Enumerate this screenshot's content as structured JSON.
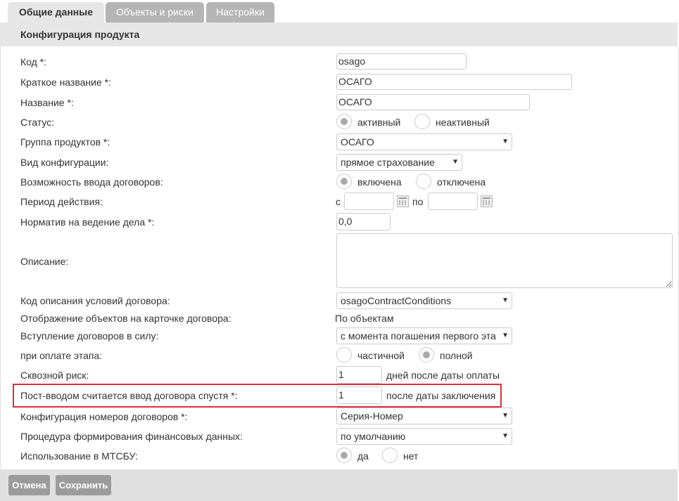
{
  "tabs": [
    {
      "label": "Общие данные"
    },
    {
      "label": "Объекты и риски"
    },
    {
      "label": "Настройки"
    }
  ],
  "section_title": "Конфигурация продукта",
  "fields": {
    "code": {
      "label": "Код *:",
      "value": "osago"
    },
    "short_name": {
      "label": "Краткое название *:",
      "value": "ОСАГО"
    },
    "name": {
      "label": "Название *:",
      "value": "ОСАГО"
    },
    "status": {
      "label": "Статус:",
      "options": [
        "активный",
        "неактивный"
      ],
      "selected": "активный"
    },
    "product_group": {
      "label": "Группа продуктов *:",
      "value": "ОСАГО"
    },
    "config_type": {
      "label": "Вид конфигурации:",
      "value": "прямое страхование"
    },
    "contract_input": {
      "label": "Возможность ввода договоров:",
      "options": [
        "включена",
        "отключена"
      ],
      "selected": "включена"
    },
    "validity_period": {
      "label": "Период действия:",
      "from_label": "с",
      "to_label": "по",
      "from_value": "",
      "to_value": ""
    },
    "business_norm": {
      "label": "Норматив на ведение дела *:",
      "value": "0,0"
    },
    "description": {
      "label": "Описание:",
      "value": ""
    },
    "contract_conditions_code": {
      "label": "Код описания условий договора:",
      "value": "osagoContractConditions"
    },
    "objects_display": {
      "label": "Отображение объектов на карточке договора:",
      "value": "По объектам"
    },
    "contract_effect": {
      "label": "Вступление договоров в силу:",
      "value": "с момента погашения первого эта"
    },
    "stage_payment": {
      "label": "при оплате этапа:",
      "options": [
        "частичной",
        "полной"
      ],
      "selected": "полной"
    },
    "through_risk": {
      "label": "Сквозной риск:",
      "value": "1",
      "suffix": "дней после даты оплаты"
    },
    "post_input": {
      "label": "Пост-вводом считается ввод договора спустя *:",
      "value": "1",
      "suffix": "после даты заключения"
    },
    "contract_numbers": {
      "label": "Конфигурация номеров договоров *:",
      "value": "Серия-Номер"
    },
    "financial_procedure": {
      "label": "Процедура формирования финансовых данных:",
      "value": "по умолчанию"
    },
    "mtsbu_usage": {
      "label": "Использование в МТСБУ:",
      "options": [
        "да",
        "нет"
      ],
      "selected": "да"
    }
  },
  "buttons": {
    "cancel": "Отмена",
    "save": "Сохранить"
  },
  "colors": {
    "highlight": "#d9303a",
    "tab_active": "#e6e6e6",
    "tab_inactive": "#b5b5b5",
    "button": "#9b9b9b"
  }
}
